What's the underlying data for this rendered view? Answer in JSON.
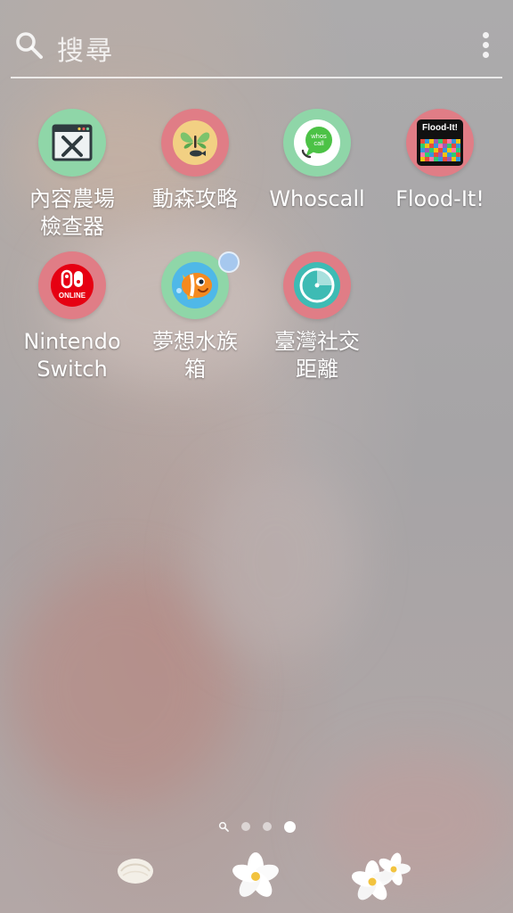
{
  "search": {
    "placeholder": "搜尋"
  },
  "apps": [
    {
      "label": "內容農場\n檢查器",
      "icon": "content-farm-checker-icon"
    },
    {
      "label": "動森攻略",
      "icon": "animal-crossing-guide-icon"
    },
    {
      "label": "Whoscall",
      "icon": "whoscall-icon",
      "icon_text": "whos\ncall"
    },
    {
      "label": "Flood-It!",
      "icon": "flood-it-icon",
      "icon_text": "Flood-It!"
    },
    {
      "label": "Nintendo\nSwitch",
      "icon": "nintendo-switch-online-icon",
      "icon_text": "ONLINE"
    },
    {
      "label": "夢想水族\n箱",
      "icon": "dream-aquarium-icon"
    },
    {
      "label": "臺灣社交\n距離",
      "icon": "taiwan-social-distancing-icon"
    }
  ],
  "page_indicator": {
    "pages": 3,
    "current": 3
  },
  "dock": [
    "shell-icon",
    "plumeria-flower-icon",
    "plumeria-flowers-icon"
  ],
  "colors": {
    "pink_ring": "#e07d86",
    "green_ring": "#8fd6a8",
    "whoscall_green": "#4cc246",
    "switch_red": "#e60012",
    "teal": "#3ebbb4",
    "badge": "#a6c8ee"
  }
}
